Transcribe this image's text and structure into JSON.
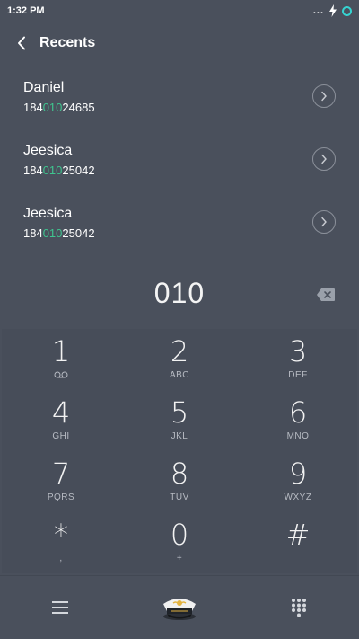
{
  "status": {
    "time": "1:32 PM",
    "dots": "..."
  },
  "header": {
    "title": "Recents"
  },
  "recents": [
    {
      "name": "Daniel",
      "number_prefix": "184",
      "number_match": "010",
      "number_suffix": "24685"
    },
    {
      "name": "Jeesica",
      "number_prefix": "184",
      "number_match": "010",
      "number_suffix": "25042"
    },
    {
      "name": "Jeesica",
      "number_prefix": "184",
      "number_match": "010",
      "number_suffix": "25042"
    }
  ],
  "dialer": {
    "number": "010"
  },
  "keys": [
    {
      "digit": "1",
      "letters": ""
    },
    {
      "digit": "2",
      "letters": "ABC"
    },
    {
      "digit": "3",
      "letters": "DEF"
    },
    {
      "digit": "4",
      "letters": "GHI"
    },
    {
      "digit": "5",
      "letters": "JKL"
    },
    {
      "digit": "6",
      "letters": "MNO"
    },
    {
      "digit": "7",
      "letters": "PQRS"
    },
    {
      "digit": "8",
      "letters": "TUV"
    },
    {
      "digit": "9",
      "letters": "WXYZ"
    },
    {
      "digit": "*",
      "letters": ","
    },
    {
      "digit": "0",
      "letters": "+"
    },
    {
      "digit": "#",
      "letters": ""
    }
  ],
  "icons": {
    "back": "chevron-left-icon",
    "detail": "chevron-right-circle-icon",
    "backspace": "backspace-icon",
    "voicemail": "voicemail-icon",
    "menu": "hamburger-menu-icon",
    "call": "captain-hat-icon",
    "keypad": "dialpad-grid-icon",
    "charging": "bolt-icon",
    "battery": "ring-icon"
  },
  "colors": {
    "background": "#4a505c",
    "match_highlight": "#3fc58f",
    "status_ring": "#36d3d0",
    "secondary_text": "#b8bcc4"
  }
}
